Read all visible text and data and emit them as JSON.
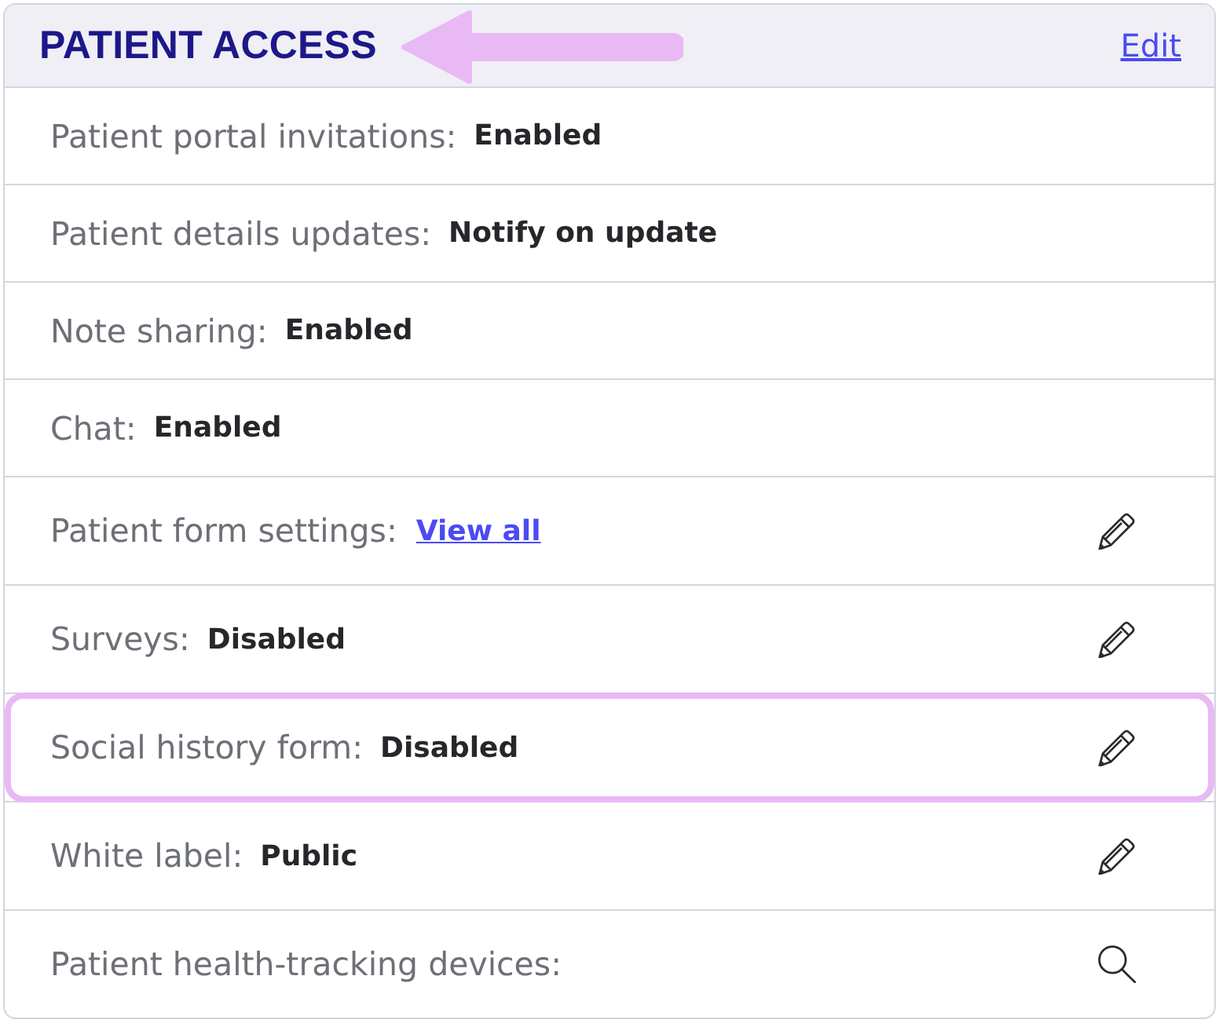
{
  "header": {
    "title": "PATIENT ACCESS",
    "arrow": true,
    "action": "Edit"
  },
  "rows": [
    {
      "kind": "static",
      "label": "Patient portal invitations:",
      "value": "Enabled",
      "highlighted": false
    },
    {
      "kind": "static",
      "label": "Patient details updates:",
      "value": "Notify on update",
      "highlighted": false
    },
    {
      "kind": "static",
      "label": "Note sharing:",
      "value": "Enabled",
      "highlighted": false
    },
    {
      "kind": "static",
      "label": "Chat:",
      "value": "Enabled",
      "highlighted": false
    },
    {
      "kind": "edit",
      "label": "Patient form settings:",
      "link": "View all",
      "highlighted": false
    },
    {
      "kind": "edit",
      "label": "Surveys:",
      "value": "Disabled",
      "highlighted": false
    },
    {
      "kind": "edit",
      "label": "Social history form:",
      "value": "Disabled",
      "highlighted": true
    },
    {
      "kind": "edit",
      "label": "White label:",
      "value": "Public",
      "highlighted": false
    },
    {
      "kind": "search",
      "label": "Patient health-tracking devices:",
      "highlighted": false
    }
  ]
}
